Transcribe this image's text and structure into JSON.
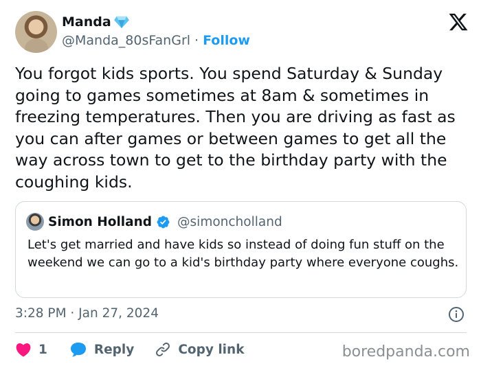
{
  "author": {
    "name": "Manda",
    "name_emoji_icon": "gem-stone-icon",
    "handle": "@Manda_80sFanGrl",
    "separator": "·",
    "follow_label": "Follow"
  },
  "platform_logo": "x-logo-icon",
  "tweet": {
    "text": "You forgot kids sports. You spend Saturday & Sunday going to games sometimes at 8am & sometimes in freezing temperatures. Then you are driving as fast as you can after games or between games to get all the way across town to get to the birthday party with the coughing kids."
  },
  "quoted_tweet": {
    "name": "Simon Holland",
    "verified_icon": "verified-badge-icon",
    "handle": "@simoncholland",
    "text": "Let's get married and have kids so instead of doing fun stuff on the weekend we can go to a kid's birthday party where everyone coughs."
  },
  "timestamp": "3:28 PM · Jan 27, 2024",
  "actions": {
    "like_count": "1",
    "reply_label": "Reply",
    "copy_link_label": "Copy link"
  },
  "watermark": "boredpanda.com",
  "colors": {
    "accent": "#1d9bf0",
    "like": "#f91880",
    "text": "#0f1419",
    "secondary_text": "#536471",
    "border": "#cfd9de"
  }
}
